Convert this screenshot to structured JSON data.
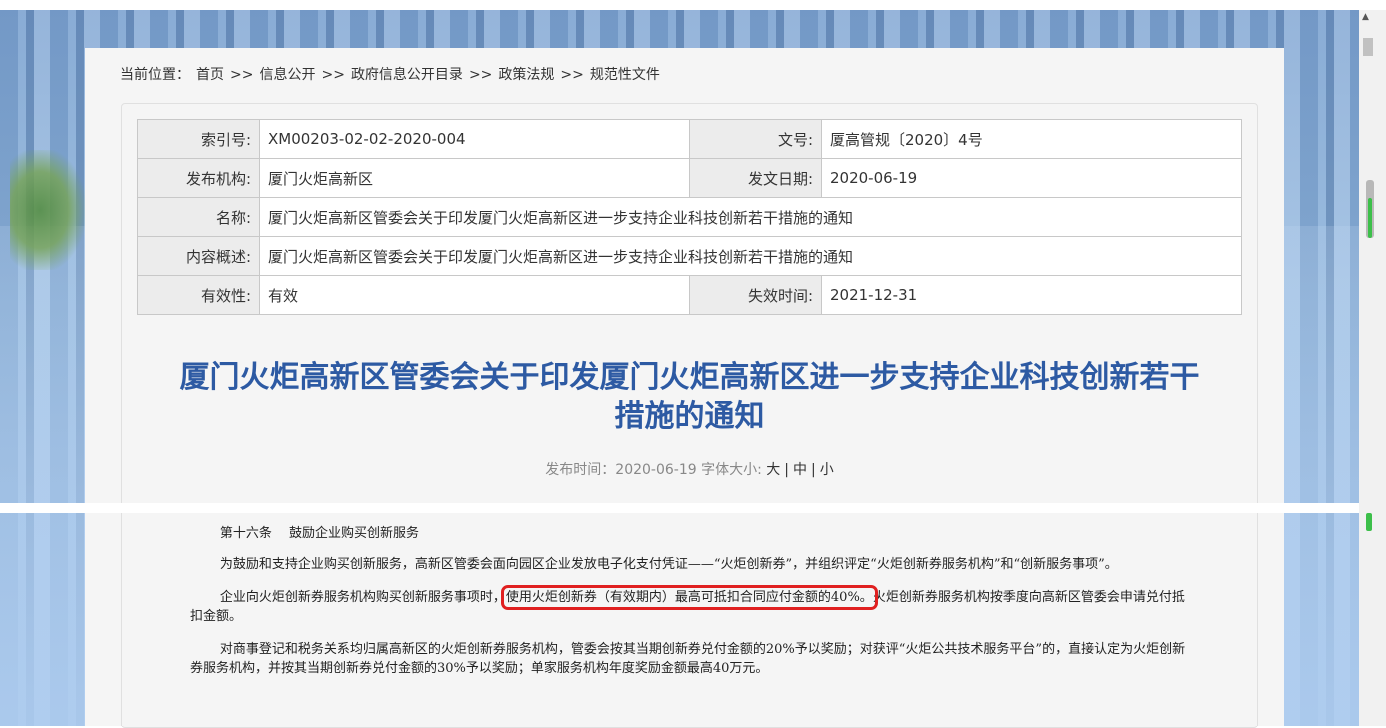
{
  "breadcrumb": {
    "prefix": "当前位置：",
    "items": [
      "首页",
      ">>",
      "信息公开",
      ">>",
      "政府信息公开目录",
      ">>",
      "政策法规",
      ">>",
      "规范性文件"
    ]
  },
  "meta": {
    "index_label": "索引号:",
    "index_value": "XM00203-02-02-2020-004",
    "doc_no_label": "文号:",
    "doc_no_value": "厦高管规〔2020〕4号",
    "issuer_label": "发布机构:",
    "issuer_value": "厦门火炬高新区",
    "date_label": "发文日期:",
    "date_value": "2020-06-19",
    "name_label": "名称:",
    "name_value": "厦门火炬高新区管委会关于印发厦门火炬高新区进一步支持企业科技创新若干措施的通知",
    "summary_label": "内容概述:",
    "summary_value": "厦门火炬高新区管委会关于印发厦门火炬高新区进一步支持企业科技创新若干措施的通知",
    "validity_label": "有效性:",
    "validity_value": "有效",
    "expiry_label": "失效时间:",
    "expiry_value": "2021-12-31"
  },
  "title": {
    "line1": "厦门火炬高新区管委会关于印发厦门火炬高新区进一步支持企业科技创新若干",
    "line2": "措施的通知"
  },
  "publish": {
    "prefix": "发布时间：2020-06-19  字体大小:",
    "size_large": "大",
    "size_medium": "中",
    "size_small": "小",
    "sep": "|"
  },
  "body": {
    "heading": "第十六条　 鼓励企业购买创新服务",
    "p1": "为鼓励和支持企业购买创新服务，高新区管委会面向园区企业发放电子化支付凭证——“火炬创新券”，并组织评定“火炬创新券服务机构”和“创新服务事项”。",
    "p2_before": "企业向火炬创新券服务机构购买创新服务事项时，",
    "p2_highlight": "使用火炬创新券（有效期内）最高可抵扣合同应付金额的40%。",
    "p2_after": "火炬创新券服务机构按季度向高新区管委会申请兑付抵扣金额。",
    "p3": "对商事登记和税务关系均归属高新区的火炬创新券服务机构，管委会按其当期创新券兑付金额的20%予以奖励；对获评“火炬公共技术服务平台”的，直接认定为火炬创新券服务机构，并按其当期创新券兑付金额的30%予以奖励；单家服务机构年度奖励金额最高40万元。"
  },
  "colors": {
    "title": "#2d5aa3",
    "highlight_box": "#e02020",
    "scroll_marker": "#3cbf4a"
  }
}
